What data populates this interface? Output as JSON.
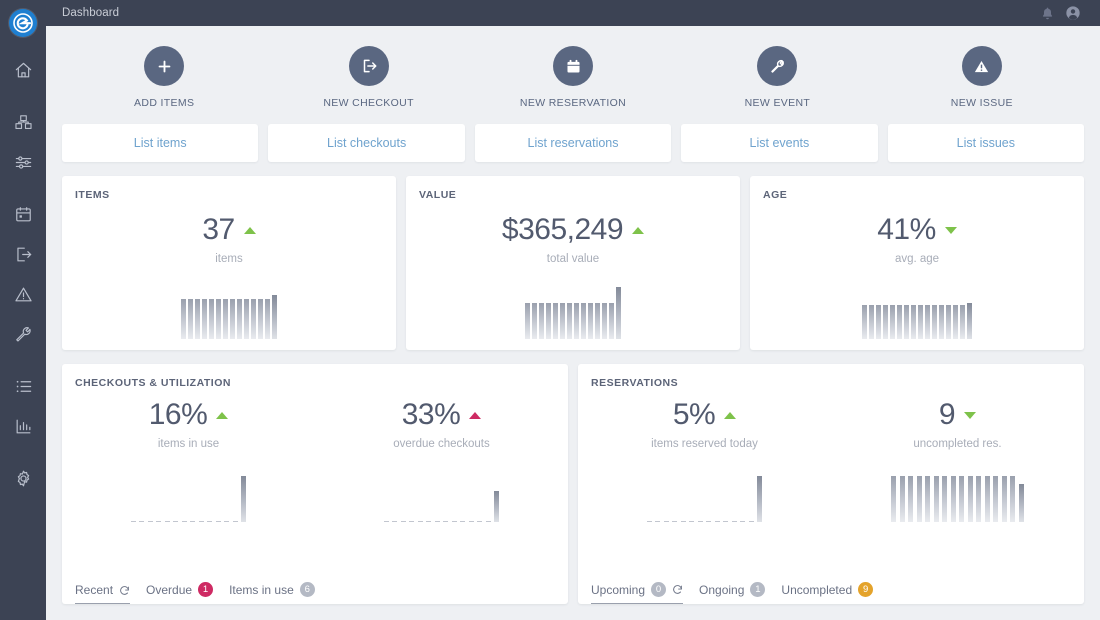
{
  "app": {
    "logo_icon": "equipment-e-logo",
    "accent_blue": "#1f7fd0",
    "link_blue": "#6fa3ce",
    "sidebar_bg": "#3c4354",
    "up_green": "#7ec24a",
    "alert_pink": "#ce2a63",
    "warn_orange": "#e4a32b"
  },
  "topbar": {
    "title": "Dashboard",
    "notifications_icon": "bell-icon",
    "account_icon": "user-avatar-icon"
  },
  "sidebar": {
    "items": [
      {
        "name": "home",
        "icon": "home-icon"
      },
      {
        "name": "items",
        "icon": "boxes-icon"
      },
      {
        "name": "attributes",
        "icon": "sliders-icon"
      },
      {
        "name": "reservations",
        "icon": "calendar-icon"
      },
      {
        "name": "checkouts",
        "icon": "checkout-arrow-icon"
      },
      {
        "name": "issues",
        "icon": "warning-triangle-icon"
      },
      {
        "name": "maintenance",
        "icon": "wrench-icon"
      },
      {
        "name": "lists",
        "icon": "list-icon"
      },
      {
        "name": "reports",
        "icon": "bar-chart-icon"
      },
      {
        "name": "settings",
        "icon": "gear-icon"
      }
    ]
  },
  "quick_actions": [
    {
      "label": "ADD ITEMS",
      "icon": "plus-icon"
    },
    {
      "label": "NEW CHECKOUT",
      "icon": "checkout-arrow-icon"
    },
    {
      "label": "NEW RESERVATION",
      "icon": "calendar-icon"
    },
    {
      "label": "NEW EVENT",
      "icon": "wrench-icon"
    },
    {
      "label": "NEW ISSUE",
      "icon": "warning-triangle-icon"
    }
  ],
  "list_buttons": [
    {
      "label": "List items"
    },
    {
      "label": "List checkouts"
    },
    {
      "label": "List reservations"
    },
    {
      "label": "List events"
    },
    {
      "label": "List issues"
    }
  ],
  "stat_cards": [
    {
      "title": "ITEMS",
      "value": "37",
      "sub": "items",
      "trend": "up",
      "trend_color": "#7ec24a"
    },
    {
      "title": "VALUE",
      "value": "$365,249",
      "sub": "total value",
      "trend": "up",
      "trend_color": "#7ec24a"
    },
    {
      "title": "AGE",
      "value": "41%",
      "sub": "avg. age",
      "trend": "down",
      "trend_color": "#7ec24a"
    }
  ],
  "panels": [
    {
      "title": "CHECKOUTS & UTILIZATION",
      "metrics": [
        {
          "value": "16%",
          "sub": "items in use",
          "trend": "up",
          "trend_color": "#7ec24a"
        },
        {
          "value": "33%",
          "sub": "overdue checkouts",
          "trend": "up",
          "trend_color": "#ce2a63"
        }
      ],
      "tabs": [
        {
          "label": "Recent",
          "badge": null,
          "badge_color": null,
          "active": true,
          "refresh": true
        },
        {
          "label": "Overdue",
          "badge": "1",
          "badge_color": "pink",
          "active": false,
          "refresh": false
        },
        {
          "label": "Items in use",
          "badge": "6",
          "badge_color": "grey",
          "active": false,
          "refresh": false
        }
      ]
    },
    {
      "title": "RESERVATIONS",
      "metrics": [
        {
          "value": "5%",
          "sub": "items reserved today",
          "trend": "up",
          "trend_color": "#7ec24a"
        },
        {
          "value": "9",
          "sub": "uncompleted res.",
          "trend": "down",
          "trend_color": "#7ec24a"
        }
      ],
      "tabs": [
        {
          "label": "Upcoming",
          "badge": "0",
          "badge_color": "grey",
          "active": true,
          "refresh": true
        },
        {
          "label": "Ongoing",
          "badge": "1",
          "badge_color": "grey",
          "active": false,
          "refresh": false
        },
        {
          "label": "Uncompleted",
          "badge": "9",
          "badge_color": "orange",
          "active": false,
          "refresh": false
        }
      ]
    }
  ],
  "chart_data": [
    {
      "type": "bar",
      "title": "ITEMS",
      "name": "items-sparkline",
      "categories": [
        "1",
        "2",
        "3",
        "4",
        "5",
        "6",
        "7",
        "8",
        "9",
        "10",
        "11",
        "12",
        "13",
        "14"
      ],
      "values": [
        40,
        40,
        40,
        40,
        40,
        40,
        40,
        40,
        40,
        40,
        40,
        40,
        40,
        44
      ],
      "ylim": [
        0,
        52
      ],
      "grid": false,
      "xlabel": "",
      "ylabel": ""
    },
    {
      "type": "bar",
      "title": "VALUE",
      "name": "value-sparkline",
      "categories": [
        "1",
        "2",
        "3",
        "4",
        "5",
        "6",
        "7",
        "8",
        "9",
        "10",
        "11",
        "12",
        "13",
        "14"
      ],
      "values": [
        36,
        36,
        36,
        36,
        36,
        36,
        36,
        36,
        36,
        36,
        36,
        36,
        36,
        52
      ],
      "ylim": [
        0,
        52
      ],
      "grid": false,
      "xlabel": "",
      "ylabel": ""
    },
    {
      "type": "bar",
      "title": "AGE",
      "name": "age-sparkline",
      "categories": [
        "1",
        "2",
        "3",
        "4",
        "5",
        "6",
        "7",
        "8",
        "9",
        "10",
        "11",
        "12",
        "13",
        "14",
        "15",
        "16"
      ],
      "values": [
        34,
        34,
        34,
        34,
        34,
        34,
        34,
        34,
        34,
        34,
        34,
        34,
        34,
        34,
        34,
        36
      ],
      "ylim": [
        0,
        52
      ],
      "grid": false,
      "xlabel": "",
      "ylabel": ""
    },
    {
      "type": "bar",
      "title": "items in use",
      "name": "items-in-use-sparkline",
      "categories": [
        "1",
        "2",
        "3",
        "4",
        "5",
        "6",
        "7",
        "8",
        "9",
        "10",
        "11",
        "12",
        "13",
        "14"
      ],
      "values": [
        1,
        1,
        1,
        1,
        1,
        1,
        1,
        1,
        1,
        1,
        1,
        1,
        1,
        46
      ],
      "ylim": [
        0,
        52
      ],
      "grid": false,
      "xlabel": "",
      "ylabel": ""
    },
    {
      "type": "bar",
      "title": "overdue checkouts",
      "name": "overdue-checkouts-sparkline",
      "categories": [
        "1",
        "2",
        "3",
        "4",
        "5",
        "6",
        "7",
        "8",
        "9",
        "10",
        "11",
        "12",
        "13",
        "14"
      ],
      "values": [
        1,
        1,
        1,
        1,
        1,
        1,
        1,
        1,
        1,
        1,
        1,
        1,
        1,
        31
      ],
      "ylim": [
        0,
        52
      ],
      "grid": false,
      "xlabel": "",
      "ylabel": ""
    },
    {
      "type": "bar",
      "title": "items reserved today",
      "name": "items-reserved-sparkline",
      "categories": [
        "1",
        "2",
        "3",
        "4",
        "5",
        "6",
        "7",
        "8",
        "9",
        "10",
        "11",
        "12",
        "13",
        "14"
      ],
      "values": [
        1,
        1,
        1,
        1,
        1,
        1,
        1,
        1,
        1,
        1,
        1,
        1,
        1,
        46
      ],
      "ylim": [
        0,
        52
      ],
      "grid": false,
      "xlabel": "",
      "ylabel": ""
    },
    {
      "type": "bar",
      "title": "uncompleted res.",
      "name": "uncompleted-res-sparkline",
      "categories": [
        "1",
        "2",
        "3",
        "4",
        "5",
        "6",
        "7",
        "8",
        "9",
        "10",
        "11",
        "12",
        "13",
        "14",
        "15",
        "16"
      ],
      "values": [
        46,
        46,
        46,
        46,
        46,
        46,
        46,
        46,
        46,
        46,
        46,
        46,
        46,
        46,
        46,
        38
      ],
      "ylim": [
        0,
        52
      ],
      "grid": false,
      "xlabel": "",
      "ylabel": ""
    }
  ]
}
